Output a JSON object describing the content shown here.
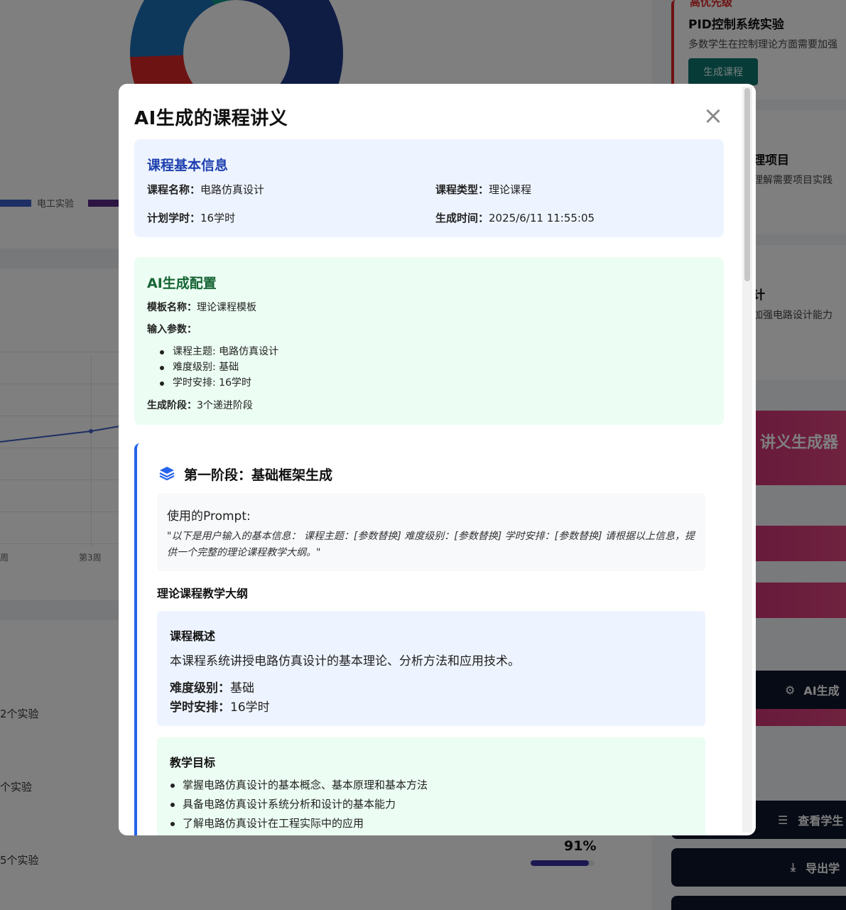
{
  "background": {
    "legend": {
      "item1": "电工实验"
    },
    "chart": {
      "week_label_1": "周",
      "week_label_3": "第3周"
    },
    "experiments": [
      "2个实验",
      "个实验",
      "5个实验"
    ],
    "progress": {
      "label": "91%",
      "value": 0.91
    },
    "right_panel": {
      "card_tag": "高优先级",
      "card_title": "PID控制系统实验",
      "card_desc": "多数学生在控制理论方面需要加强",
      "generate_button": "生成课程",
      "card2_title": "理项目",
      "card2_desc": "理解需要项目实践",
      "card3_title": "计",
      "card3_desc": "加强电路设计能力",
      "generator_title": "讲义生成器",
      "ai_button": "AI生成",
      "view_button": "查看学生",
      "export_button": "导出学"
    }
  },
  "modal": {
    "title": "AI生成的课程讲义",
    "close_label": "×",
    "basic_info": {
      "heading": "课程基本信息",
      "name_label": "课程名称：",
      "name_value": "电路仿真设计",
      "type_label": "课程类型：",
      "type_value": "理论课程",
      "hours_label": "计划学时：",
      "hours_value": "16学时",
      "time_label": "生成时间：",
      "time_value": "2025/6/11 11:55:05"
    },
    "ai_config": {
      "heading": "AI生成配置",
      "template_label": "模板名称：",
      "template_value": "理论课程模板",
      "params_label": "输入参数：",
      "params": [
        "课程主题: 电路仿真设计",
        "难度级别: 基础",
        "学时安排: 16学时"
      ],
      "stages_label": "生成阶段：",
      "stages_value": "3个递进阶段"
    },
    "stage1": {
      "title": "第一阶段：基础框架生成",
      "prompt_label": "使用的Prompt:",
      "prompt_text": "\"以下是用户输入的基本信息： 课程主题：[参数替换] 难度级别：[参数替换] 学时安排：[参数替换] 请根据以上信息，提供一个完整的理论课程教学大纲。\"",
      "outline_title": "理论课程教学大纲",
      "overview": {
        "heading": "课程概述",
        "text": "本课程系统讲授电路仿真设计的基本理论、分析方法和应用技术。",
        "level_label": "难度级别：",
        "level_value": "基础",
        "hours_label": "学时安排：",
        "hours_value": "16学时"
      },
      "goals": {
        "heading": "教学目标",
        "items": [
          "掌握电路仿真设计的基本概念、基本原理和基本方法",
          "具备电路仿真设计系统分析和设计的基本能力",
          "了解电路仿真设计在工程实际中的应用"
        ]
      }
    }
  },
  "colors": {
    "accent_blue": "#1e40af",
    "accent_green": "#166534",
    "stage_border": "#2563eb",
    "danger": "#dc2626"
  }
}
